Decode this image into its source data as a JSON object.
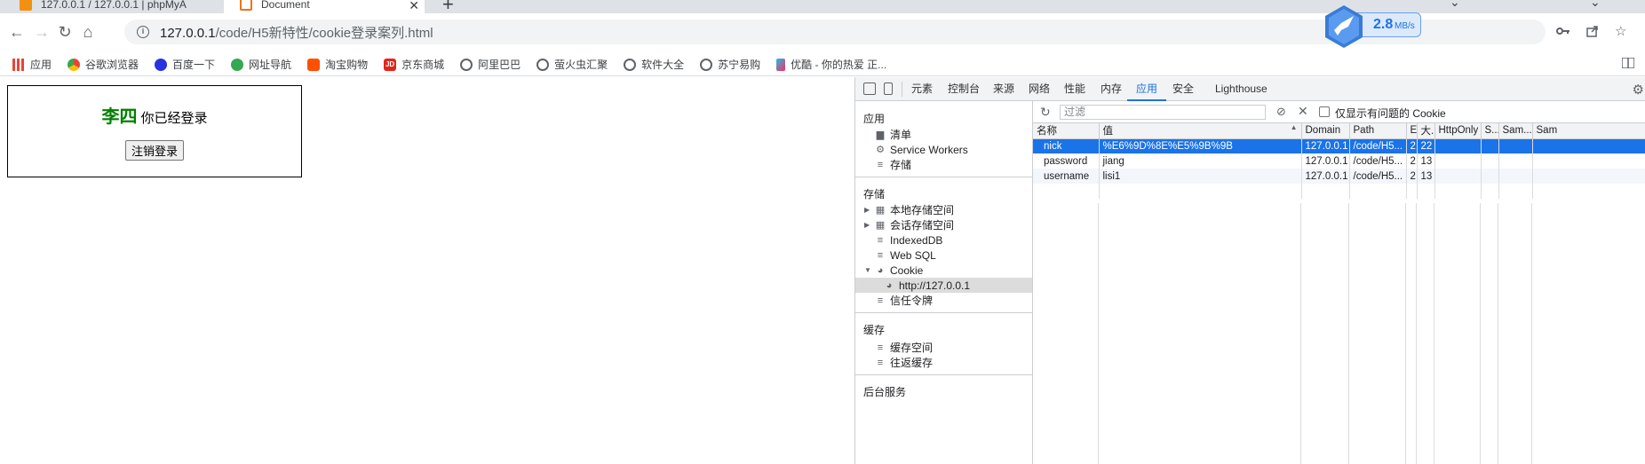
{
  "tabs": [
    {
      "title": "127.0.0.1 / 127.0.0.1 | phpMyA"
    },
    {
      "title": "Document"
    }
  ],
  "toolbar": {
    "back": "←",
    "forward": "→",
    "reload": "↻",
    "home": "⌂",
    "url_host": "127.0.0.1",
    "url_path": "/code/H5新特性/cookie登录案列.html",
    "key_icon": "key-icon",
    "share_icon": "share-icon",
    "star_icon": "star-icon"
  },
  "speed": {
    "value": "2.8",
    "unit": "MB/s"
  },
  "bookmarks": [
    {
      "label": "应用",
      "color": "#ea4335"
    },
    {
      "label": "谷歌浏览器",
      "color": "#4285f4"
    },
    {
      "label": "百度一下",
      "color": "#2932e1"
    },
    {
      "label": "网址导航",
      "color": "#34a853"
    },
    {
      "label": "淘宝购物",
      "color": "#ff5000"
    },
    {
      "label": "京东商城",
      "color": "#e1251b"
    },
    {
      "label": "阿里巴巴",
      "color": "#5f6368"
    },
    {
      "label": "萤火虫汇聚",
      "color": "#5f6368"
    },
    {
      "label": "软件大全",
      "color": "#5f6368"
    },
    {
      "label": "苏宁易购",
      "color": "#5f6368"
    },
    {
      "label": "优酷 - 你的热爱 正...",
      "color": "#1ebcf2"
    }
  ],
  "page": {
    "username": "李四",
    "logged_in_text": "你已经登录",
    "logout_label": "注销登录"
  },
  "devtools": {
    "tabs": [
      "元素",
      "控制台",
      "来源",
      "网络",
      "性能",
      "内存",
      "应用",
      "安全",
      "Lighthouse"
    ],
    "active_tab": "应用",
    "sidebar": {
      "app_title": "应用",
      "app_items": [
        "清单",
        "Service Workers",
        "存储"
      ],
      "storage_title": "存储",
      "storage_items": [
        "本地存储空间",
        "会话存储空间",
        "IndexedDB",
        "Web SQL",
        "Cookie"
      ],
      "cookie_origin": "http://127.0.0.1",
      "trust_tokens": "信任令牌",
      "cache_title": "缓存",
      "cache_items": [
        "缓存空间",
        "往返缓存"
      ],
      "background_title": "后台服务"
    },
    "filter": {
      "placeholder": "过滤",
      "only_issues_label": "仅显示有问题的 Cookie"
    },
    "cookie_table": {
      "headers": [
        "名称",
        "值",
        "Domain",
        "Path",
        "E.",
        "大.",
        "HttpOnly",
        "S...",
        "Sam...",
        "Sam"
      ],
      "rows": [
        {
          "name": "nick",
          "value": "%E6%9D%8E%E5%9B%9B",
          "domain": "127.0.0.1",
          "path": "/code/H5...",
          "expires": "2.",
          "size": "22"
        },
        {
          "name": "password",
          "value": "jiang",
          "domain": "127.0.0.1",
          "path": "/code/H5...",
          "expires": "2.",
          "size": "13"
        },
        {
          "name": "username",
          "value": "lisi1",
          "domain": "127.0.0.1",
          "path": "/code/H5...",
          "expires": "2.",
          "size": "13"
        }
      ]
    }
  }
}
